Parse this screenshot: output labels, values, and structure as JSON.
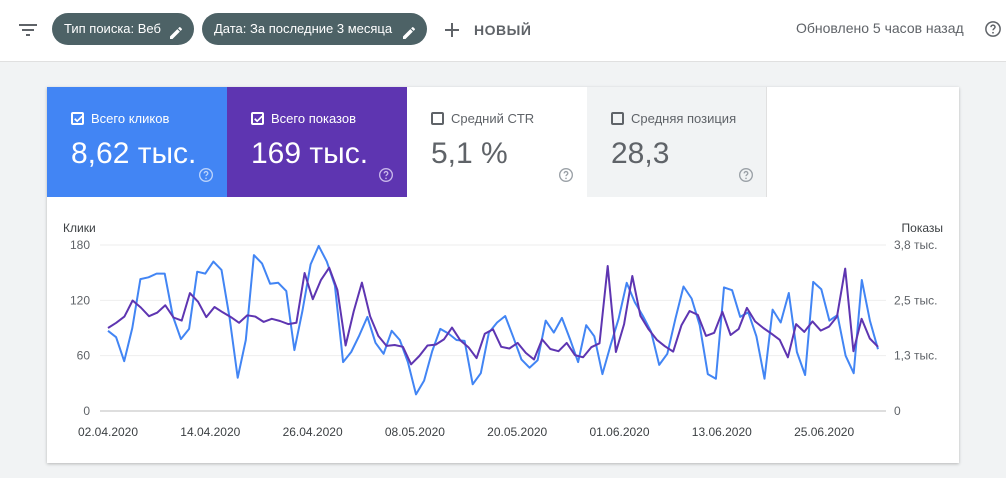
{
  "topbar": {
    "filter_icon": "filter-list-icon",
    "chip_search_type": "Тип поиска: Веб",
    "chip_date": "Дата: За последние 3 месяца",
    "new_button": "НОВЫЙ",
    "updated": "Обновлено 5 часов назад",
    "help_icon": "help-icon"
  },
  "metrics": {
    "clicks": {
      "label": "Всего кликов",
      "value": "8,62 тыс.",
      "checked": true,
      "color": "#4285f4"
    },
    "impressions": {
      "label": "Всего показов",
      "value": "169 тыс.",
      "checked": true,
      "color": "#5e35b1"
    },
    "ctr": {
      "label": "Средний CTR",
      "value": "5,1 %",
      "checked": false
    },
    "position": {
      "label": "Средняя позиция",
      "value": "28,3",
      "checked": false
    }
  },
  "chart_data": {
    "type": "line",
    "ylabel_left": "Клики",
    "ylabel_right": "Показы",
    "left_ticks": [
      "180",
      "120",
      "60",
      "0"
    ],
    "right_ticks": [
      "3,8 тыс.",
      "2,5 тыс.",
      "1,3 тыс.",
      "0"
    ],
    "ylim_left": [
      0,
      180
    ],
    "ylim_right": [
      0,
      3800
    ],
    "x_labels": [
      "02.04.2020",
      "14.04.2020",
      "26.04.2020",
      "08.05.2020",
      "20.05.2020",
      "01.06.2020",
      "13.06.2020",
      "25.06.2020"
    ],
    "grid": true,
    "series": [
      {
        "name": "Клики",
        "axis": "left",
        "color": "#4285f4",
        "values": [
          87,
          80,
          54,
          90,
          143,
          145,
          149,
          149,
          103,
          78,
          89,
          151,
          149,
          162,
          153,
          101,
          36,
          77,
          169,
          160,
          138,
          139,
          130,
          66,
          109,
          159,
          179,
          162,
          136,
          53,
          64,
          82,
          102,
          74,
          62,
          87,
          77,
          53,
          18,
          33,
          65,
          89,
          84,
          77,
          76,
          29,
          41,
          85,
          96,
          103,
          80,
          56,
          47,
          55,
          98,
          85,
          101,
          78,
          53,
          93,
          81,
          40,
          71,
          100,
          139,
          118,
          103,
          86,
          50,
          62,
          100,
          135,
          122,
          93,
          40,
          35,
          134,
          131,
          102,
          107,
          81,
          35,
          110,
          96,
          128,
          64,
          39,
          140,
          132,
          98,
          104,
          60,
          41,
          142,
          98,
          67
        ]
      },
      {
        "name": "Показы",
        "axis": "right",
        "color": "#5e35b1",
        "values": [
          1900,
          2020,
          2160,
          2530,
          2370,
          2170,
          2250,
          2420,
          2140,
          2070,
          2700,
          2500,
          2150,
          2380,
          2260,
          2150,
          2020,
          2190,
          2160,
          2040,
          2110,
          2060,
          1990,
          2020,
          3160,
          2560,
          3000,
          3280,
          2770,
          1500,
          2280,
          2940,
          2170,
          1720,
          1490,
          1510,
          1470,
          1070,
          1260,
          1500,
          1520,
          1640,
          1910,
          1620,
          1460,
          1210,
          1770,
          1870,
          1470,
          1430,
          1560,
          1330,
          1180,
          1640,
          1420,
          1370,
          1560,
          1280,
          1230,
          1460,
          1550,
          3320,
          1350,
          1990,
          3090,
          2180,
          1870,
          1630,
          1480,
          1360,
          1960,
          2290,
          2200,
          1720,
          1790,
          2270,
          1740,
          1880,
          2360,
          2050,
          1900,
          1770,
          1630,
          1230,
          1990,
          1810,
          2050,
          1840,
          1930,
          2160,
          3260,
          1370,
          2110,
          1660,
          1470
        ]
      }
    ]
  }
}
